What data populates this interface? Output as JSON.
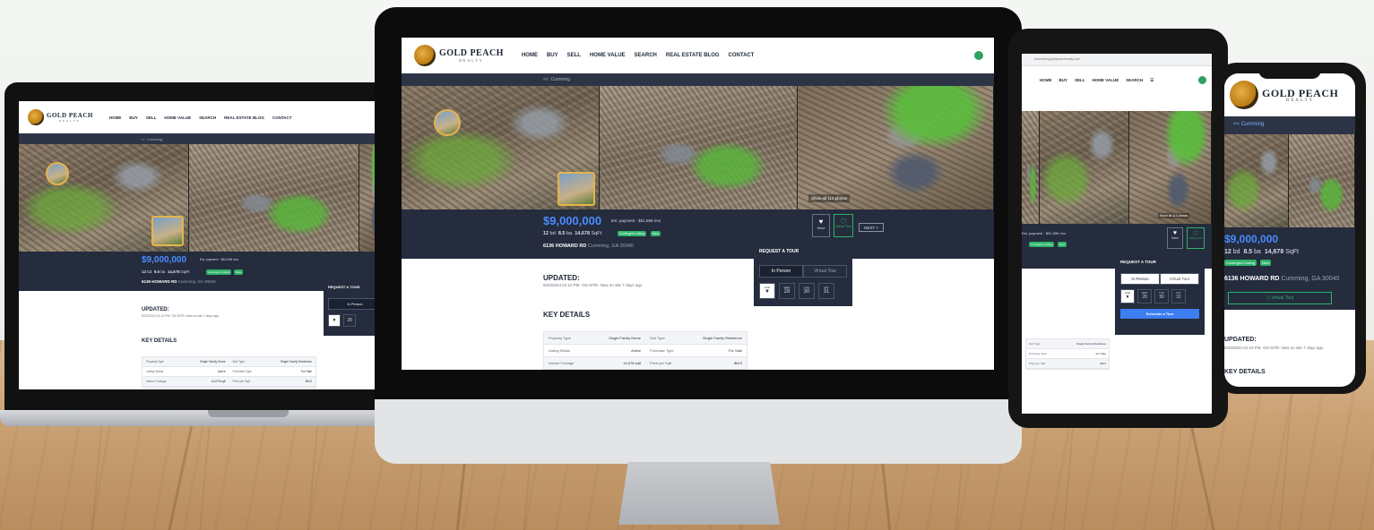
{
  "brand": {
    "name": "GOLD PEACH",
    "sub": "REALTY"
  },
  "nav": {
    "items": [
      "HOME",
      "BUY",
      "SELL",
      "HOME VALUE",
      "SEARCH",
      "REAL ESTATE BLOG",
      "CONTACT"
    ],
    "tablet_items": [
      "HOME",
      "BUY",
      "SELL",
      "HOME VALUE",
      "SEARCH"
    ]
  },
  "breadcrumb": {
    "back": "<<",
    "label": "Cumming"
  },
  "tablet_url": "tours/listing/goldpeachrealty.com",
  "listing": {
    "price": "$9,000,000",
    "est_payment": "$51,596 /mo",
    "est_label": "Est. payment",
    "beds": "12",
    "beds_unit": "bd",
    "baths": "8.5",
    "baths_unit": "ba",
    "sqft": "14,678",
    "sqft_unit": "SqFt",
    "status_badge": "Contingent Listing",
    "new_badge": "New",
    "address": "6136 HOWARD RD",
    "city": "Cumming, GA 30040",
    "show_all": "Show all 114 photos",
    "save_label": "Save",
    "virtual_tour_label": "Virtual Tour",
    "next_label": "NEXT >"
  },
  "updated": {
    "heading": "UPDATED:",
    "text": "8/23/2024 01:10 PM",
    "onsite": "ON SITE: New on site 7 days ago"
  },
  "key_details": {
    "heading": "KEY DETAILS",
    "rows": [
      [
        [
          "Property Type",
          "Single Family Home"
        ],
        [
          "Sub Type",
          "Single Family Residence"
        ]
      ],
      [
        [
          "Listing Status",
          "Active"
        ],
        [
          "Purchase Type",
          "For Sale"
        ]
      ],
      [
        [
          "Interior Footage",
          "14,678 sqft"
        ],
        [
          "Price per Sqft",
          "$613"
        ]
      ]
    ]
  },
  "tour": {
    "heading": "REQUEST A TOUR",
    "tab_in_person": "In Person",
    "tab_virtual": "Virtual Tour",
    "days": [
      {
        "dow": "AUG",
        "num": "▼"
      },
      {
        "dow": "WED",
        "num": "28"
      },
      {
        "dow": "THU",
        "num": "30"
      },
      {
        "dow": "SAT",
        "num": "31"
      }
    ],
    "schedule": "Schedule a Tour"
  }
}
